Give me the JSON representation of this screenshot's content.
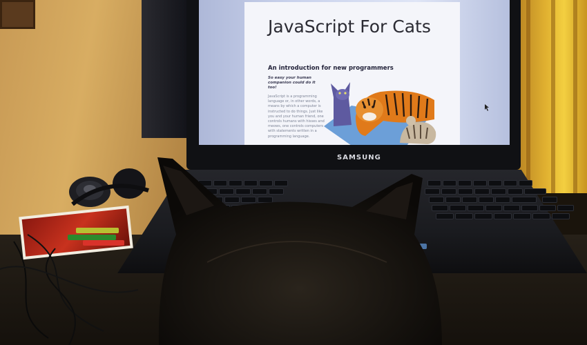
{
  "screen_page": {
    "title": "JavaScript For Cats",
    "subtitle": "An introduction for new programmers",
    "lead": "So easy your human companion could do it too!",
    "body": "JavaScript is a programming language or, in other words, a means by which a computer is instructed to do things. Just like you and your human friend, one controls humans with hisses and meows, one controls computers with statements written in a programming language."
  },
  "laptop": {
    "brand": "SAMSUNG"
  },
  "colors": {
    "screen_bg": "#dfe5f6",
    "page_bg": "#f4f5fa",
    "title_text": "#2b2b33",
    "tiger_orange": "#e07a1a",
    "cat_purple": "#5e5aa0",
    "blanket_blue": "#6c9fd8",
    "wall_yellow": "#e0b030"
  },
  "icons": {
    "cursor": "mouse-cursor-icon",
    "illustration": "cats-and-tiger-illustration"
  }
}
